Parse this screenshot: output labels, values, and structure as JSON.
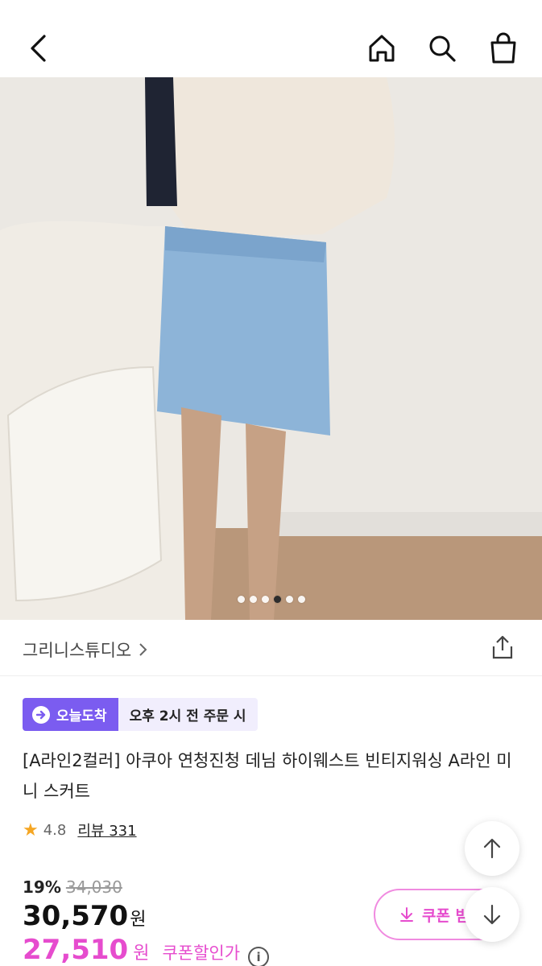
{
  "header": {
    "back_icon": "chevron-left-icon",
    "home_icon": "home-icon",
    "search_icon": "search-icon",
    "cart_icon": "shopping-bag-icon"
  },
  "gallery": {
    "image_description": "product photo",
    "slide_count": 6,
    "active_slide": 4
  },
  "brand": {
    "name": "그리니스튜디오",
    "share_icon": "share-icon"
  },
  "delivery": {
    "badge_label": "오늘도착",
    "cutoff_text": "오후 2시 전 주문 시"
  },
  "product": {
    "title": "[A라인2컬러] 아쿠아 연청진청 데님 하이웨스트 빈티지워싱 A라인 미니 스커트",
    "rating": "4.8",
    "review_label": "리뷰 331"
  },
  "pricing": {
    "discount_rate": "19%",
    "original_price": "34,030",
    "price": "30,570",
    "currency": "원",
    "coupon_price": "27,510",
    "coupon_label": "쿠폰할인가",
    "coupon_button": "쿠폰 받"
  },
  "colors": {
    "accent_purple": "#7b5cf0",
    "accent_pink": "#e64cce"
  }
}
